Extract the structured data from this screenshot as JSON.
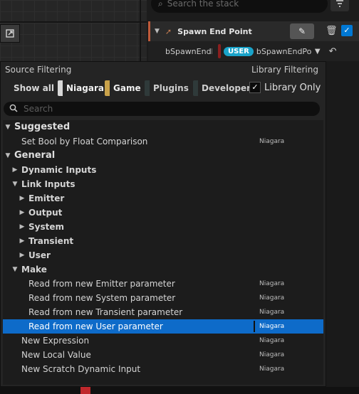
{
  "stack": {
    "search_placeholder": "Search the stack",
    "module_title": "Spawn End Point",
    "param_name": "bSpawnEndI",
    "param_badge": "USER",
    "param_value": "bSpawnEndPoi"
  },
  "popup": {
    "source_filtering_label": "Source Filtering",
    "library_filtering_label": "Library Filtering",
    "show_all_label": "Show all",
    "chips": [
      {
        "label": "Niagara",
        "color": "#d8d8d8",
        "active": true
      },
      {
        "label": "Game",
        "color": "#c9a24a",
        "active": true
      },
      {
        "label": "Plugins",
        "color": "#2f3a3a",
        "active": false
      },
      {
        "label": "Developer",
        "color": "#2f3a3a",
        "active": false
      }
    ],
    "library_only_label": "Library Only",
    "library_only_checked": true,
    "search_placeholder": "Search",
    "tree": {
      "suggested": "Suggested",
      "suggested_item": "Set Bool by Float Comparison",
      "suggested_item_source": "Niagara",
      "general": "General",
      "dynamic_inputs": "Dynamic Inputs",
      "link_inputs": "Link Inputs",
      "emitter": "Emitter",
      "output": "Output",
      "system": "System",
      "transient": "Transient",
      "user": "User",
      "make": "Make",
      "make_items": [
        {
          "label": "Read from new Emitter parameter",
          "source": "Niagara"
        },
        {
          "label": "Read from new System parameter",
          "source": "Niagara"
        },
        {
          "label": "Read from new Transient parameter",
          "source": "Niagara"
        },
        {
          "label": "Read from new User parameter",
          "source": "Niagara"
        }
      ],
      "general_items": [
        {
          "label": "New Expression",
          "source": "Niagara"
        },
        {
          "label": "New Local Value",
          "source": "Niagara"
        },
        {
          "label": "New Scratch Dynamic Input",
          "source": "Niagara"
        }
      ]
    }
  },
  "colors": {
    "selection": "#0e6bc9",
    "user_badge": "#1aa3c9",
    "checkbox": "#0078d4"
  }
}
